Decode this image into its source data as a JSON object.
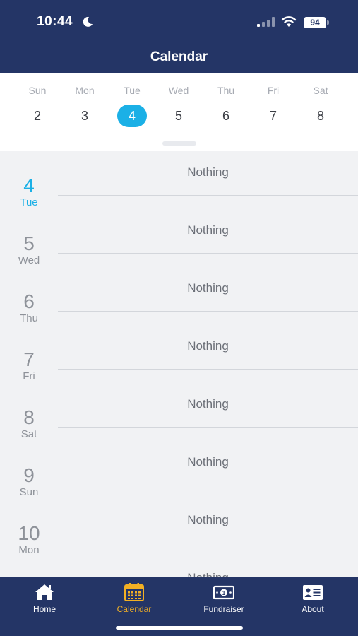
{
  "status": {
    "time": "10:44",
    "battery": "94"
  },
  "header": {
    "title": "Calendar"
  },
  "week": [
    {
      "name": "Sun",
      "num": "2"
    },
    {
      "name": "Mon",
      "num": "3"
    },
    {
      "name": "Tue",
      "num": "4",
      "selected": true
    },
    {
      "name": "Wed",
      "num": "5"
    },
    {
      "name": "Thu",
      "num": "6"
    },
    {
      "name": "Fri",
      "num": "7"
    },
    {
      "name": "Sat",
      "num": "8"
    }
  ],
  "agenda": [
    {
      "num": "4",
      "weekday": "Tue",
      "event": "Nothing",
      "active": true
    },
    {
      "num": "5",
      "weekday": "Wed",
      "event": "Nothing"
    },
    {
      "num": "6",
      "weekday": "Thu",
      "event": "Nothing"
    },
    {
      "num": "7",
      "weekday": "Fri",
      "event": "Nothing"
    },
    {
      "num": "8",
      "weekday": "Sat",
      "event": "Nothing"
    },
    {
      "num": "9",
      "weekday": "Sun",
      "event": "Nothing"
    },
    {
      "num": "10",
      "weekday": "Mon",
      "event": "Nothing"
    },
    {
      "num": "",
      "weekday": "",
      "event": "Nothing"
    }
  ],
  "tabs": [
    {
      "label": "Home",
      "icon": "home-icon"
    },
    {
      "label": "Calendar",
      "icon": "calendar-icon",
      "active": true
    },
    {
      "label": "Fundraiser",
      "icon": "money-icon"
    },
    {
      "label": "About",
      "icon": "id-card-icon"
    }
  ],
  "colors": {
    "navy": "#243566",
    "accent": "#1bb0e6",
    "tab_active": "#f2b024"
  }
}
